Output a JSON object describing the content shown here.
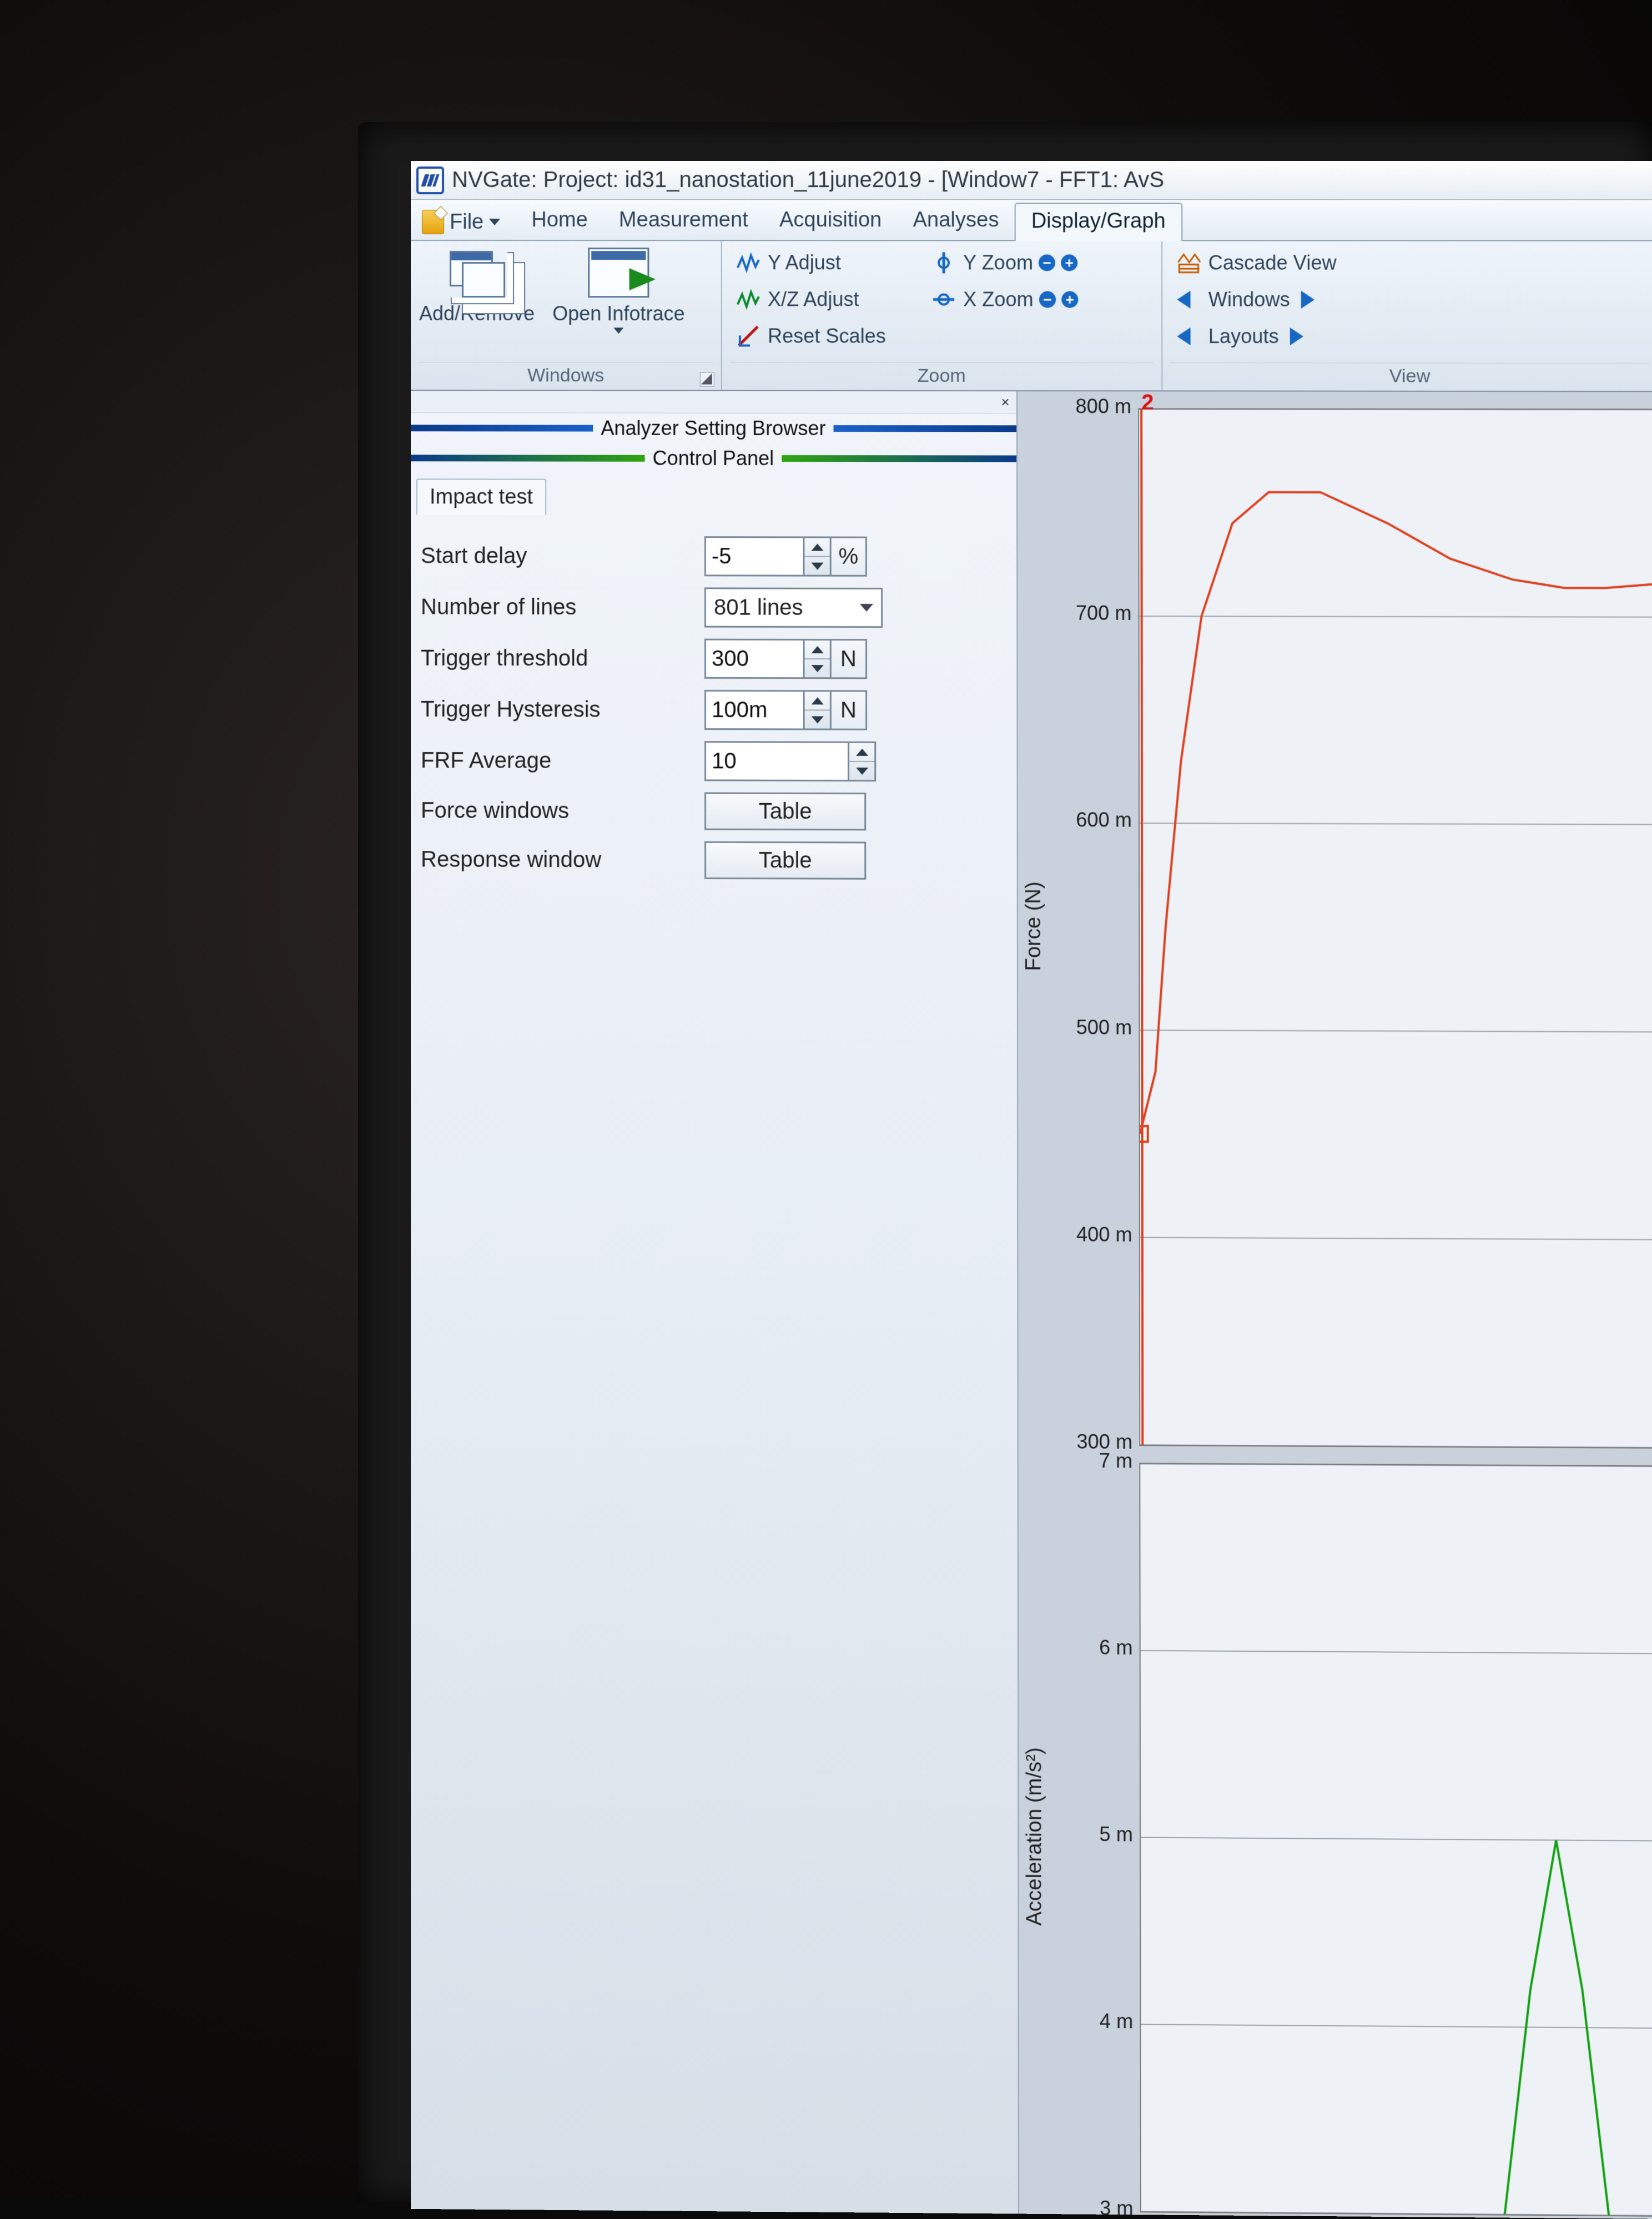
{
  "title": "NVGate: Project: id31_nanostation_11june2019 - [Window7 - FFT1: AvS",
  "ribbon_tabs": {
    "file": "File",
    "home": "Home",
    "measurement": "Measurement",
    "acquisition": "Acquisition",
    "analyses": "Analyses",
    "display_graph": "Display/Graph",
    "active": "display_graph"
  },
  "ribbon": {
    "groups": {
      "windows": {
        "label": "Windows",
        "add_remove": "Add/Remove",
        "open_infotrace": "Open Infotrace"
      },
      "zoom": {
        "label": "Zoom",
        "y_adjust": "Y Adjust",
        "xz_adjust": "X/Z Adjust",
        "reset_scales": "Reset Scales",
        "y_zoom": "Y Zoom",
        "x_zoom": "X Zoom"
      },
      "view": {
        "label": "View",
        "cascade_view": "Cascade View",
        "windows": "Windows",
        "layouts": "Layouts"
      }
    }
  },
  "left_pane": {
    "analyzer_hdr": "Analyzer Setting Browser",
    "control_hdr": "Control Panel",
    "section_tab": "Impact test",
    "form": {
      "start_delay": {
        "label": "Start delay",
        "value": "-5",
        "unit": "%"
      },
      "number_of_lines": {
        "label": "Number of lines",
        "value": "801 lines"
      },
      "trigger_threshold": {
        "label": "Trigger threshold",
        "value": "300",
        "unit": "N"
      },
      "trigger_hysteresis": {
        "label": "Trigger Hysteresis",
        "value": "100m",
        "unit": "N"
      },
      "frf_average": {
        "label": "FRF Average",
        "value": "10"
      },
      "force_windows": {
        "label": "Force windows",
        "button": "Table"
      },
      "response_window": {
        "label": "Response window",
        "button": "Table"
      }
    }
  },
  "charts": {
    "top": {
      "legend_tag": "2",
      "ylabel": "Force (N)",
      "yticks": [
        "800 m",
        "700 m",
        "600 m",
        "500 m",
        "400 m",
        "300 m"
      ]
    },
    "bottom": {
      "ylabel": "Acceleration (m/s²)",
      "yticks": [
        "7 m",
        "6 m",
        "5 m",
        "4 m",
        "3 m"
      ]
    }
  },
  "chart_data": [
    {
      "type": "line",
      "title": "",
      "ylabel": "Force (N)",
      "xlabel": "",
      "ylim": [
        300,
        800
      ],
      "series": [
        {
          "name": "2",
          "color": "#e04020",
          "x": [
            0.0,
            0.03,
            0.05,
            0.08,
            0.12,
            0.18,
            0.25,
            0.35,
            0.48,
            0.6,
            0.72,
            0.82,
            0.9,
            1.0
          ],
          "values": [
            450,
            480,
            550,
            630,
            700,
            745,
            760,
            760,
            745,
            728,
            718,
            714,
            714,
            716
          ]
        }
      ],
      "markers": [
        {
          "x": 0.0,
          "y": 450,
          "shape": "square",
          "color": "#e04020"
        }
      ],
      "note": "x is fractional position across the visible plot width; screenshot is cropped so true x-axis units not visible"
    },
    {
      "type": "line",
      "title": "",
      "ylabel": "Acceleration (m/s²)",
      "xlabel": "",
      "ylim": [
        3,
        7
      ],
      "series": [
        {
          "name": "",
          "color": "#10a010",
          "x": [
            0.7,
            0.75,
            0.8,
            0.85,
            0.9
          ],
          "values": [
            3.0,
            4.2,
            5.0,
            4.2,
            3.0
          ]
        }
      ],
      "note": "only the tip of a peak is visible at the bottom-right; values approximate"
    }
  ]
}
